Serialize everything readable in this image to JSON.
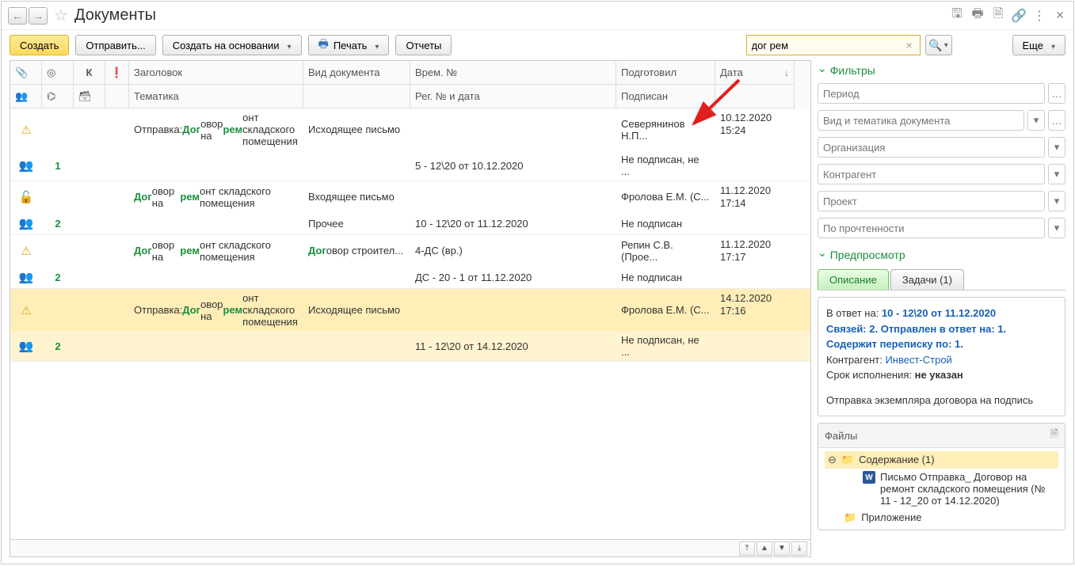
{
  "title": "Документы",
  "toolbar": {
    "create": "Создать",
    "send": "Отправить...",
    "create_on": "Создать на основании",
    "print": "Печать",
    "reports": "Отчеты",
    "more": "Еще"
  },
  "search": {
    "value": "дог рем"
  },
  "table": {
    "headers": {
      "title": "Заголовок",
      "doc_type": "Вид документа",
      "temp_no": "Врем. №",
      "prepared": "Подготовил",
      "date": "Дата",
      "topic": "Тематика",
      "reg_no": "Рег. № и дата",
      "signed": "Подписан"
    },
    "rows": [
      {
        "ico1": "⚠",
        "ico1c": "",
        "ico2": "👥",
        "ico2c": "green",
        "num": "1",
        "title_pre": "Отправка: ",
        "title_hl1": "Дог",
        "title_mid": "овор на ",
        "title_hl2": "рем",
        "title_post": "онт складского помещения",
        "doc_type": "Исходящее письмо",
        "temp_no": "",
        "prepared": "Северянинов Н.П...",
        "date": "10.12.2020",
        "time": "15:24",
        "topic": "",
        "reg_no": "5 - 12\\20 от 10.12.2020",
        "signed": "Не подписан, не ..."
      },
      {
        "ico1": "🔓",
        "ico1c": "grey",
        "ico2": "👥",
        "ico2c": "green",
        "num": "2",
        "title_pre": "",
        "title_hl1": "Дог",
        "title_mid": "овор на ",
        "title_hl2": "рем",
        "title_post": "онт складского помещения",
        "doc_type": "Входящее письмо",
        "temp_no": "",
        "prepared": "Фролова Е.М. (С...",
        "date": "11.12.2020",
        "time": "17:14",
        "topic": "Прочее",
        "reg_no": "10 - 12\\20 от 11.12.2020",
        "signed": "Не подписан"
      },
      {
        "ico1": "⚠",
        "ico1c": "",
        "ico2": "👥",
        "ico2c": "green",
        "num": "2",
        "title_pre": "",
        "title_hl1": "Дог",
        "title_mid": "овор на ",
        "title_hl2": "рем",
        "title_post": "онт складского помещения",
        "doc_type_hl": "Дог",
        "doc_type_post": "овор строител...",
        "temp_no": "4-ДС (вр.)",
        "prepared": "Репин С.В. (Прое...",
        "date": "11.12.2020",
        "time": "17:17",
        "topic": "",
        "reg_no": "ДС - 20 - 1 от 11.12.2020",
        "signed": "Не подписан"
      },
      {
        "selected": true,
        "ico1": "⚠",
        "ico1c": "",
        "ico2": "👥",
        "ico2c": "green",
        "num": "2",
        "title_pre": "Отправка: ",
        "title_hl1": "Дог",
        "title_mid": "овор на ",
        "title_hl2": "рем",
        "title_post": "онт складского помещения",
        "doc_type": "Исходящее письмо",
        "temp_no": "",
        "prepared": "Фролова Е.М. (С...",
        "date": "14.12.2020",
        "time": "17:16",
        "topic": "",
        "reg_no": "11 - 12\\20 от 14.12.2020",
        "signed": "Не подписан, не ..."
      }
    ]
  },
  "sidebar": {
    "filters_title": "Фильтры",
    "filters": {
      "period": "Период",
      "kind": "Вид и тематика документа",
      "org": "Организация",
      "contractor": "Контрагент",
      "project": "Проект",
      "read": "По прочтенности"
    },
    "preview_title": "Предпросмотр",
    "tabs": {
      "desc": "Описание",
      "tasks": "Задачи (1)"
    },
    "preview": {
      "reply_label": "В ответ на: ",
      "reply_link": "10 - 12\\20 от 11.12.2020",
      "line2": "Связей: 2. Отправлен в ответ на: 1. Содержит переписку по: 1.",
      "contractor_label": "Контрагент: ",
      "contractor": "Инвест-Строй",
      "deadline_label": "Срок исполнения: ",
      "deadline": "не указан",
      "body": "Отправка экземпляра договора на подпись"
    },
    "files": {
      "title": "Файлы",
      "content": "Содержание (1)",
      "file": "Письмо Отправка_ Договор на ремонт складского помещения (№ 11 - 12_20 от 14.12.2020)",
      "attach": "Приложение"
    }
  }
}
